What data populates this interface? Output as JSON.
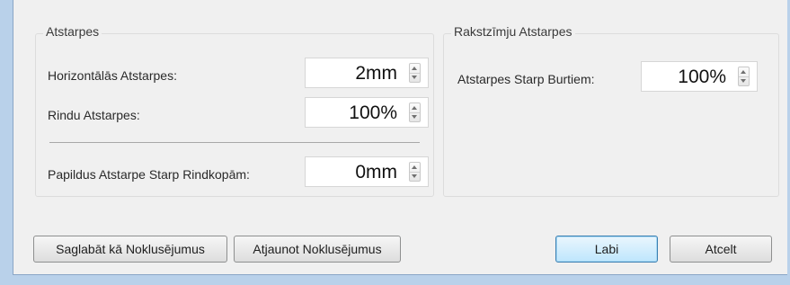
{
  "spacing_group": {
    "title": "Atstarpes",
    "horizontal_label": "Horizontālās Atstarpes:",
    "horizontal_value": "2mm",
    "line_label": "Rindu Atstarpes:",
    "line_value": "100%",
    "paragraph_label": "Papildus Atstarpe Starp Rindkopām:",
    "paragraph_value": "0mm"
  },
  "char_group": {
    "title": "Rakstzīmju Atstarpes",
    "letter_label": "Atstarpes Starp Burtiem:",
    "letter_value": "100%"
  },
  "buttons": {
    "save_defaults": "Saglabāt kā Noklusējumus",
    "restore_defaults": "Atjaunot Noklusējumus",
    "ok": "Labi",
    "cancel": "Atcelt"
  }
}
